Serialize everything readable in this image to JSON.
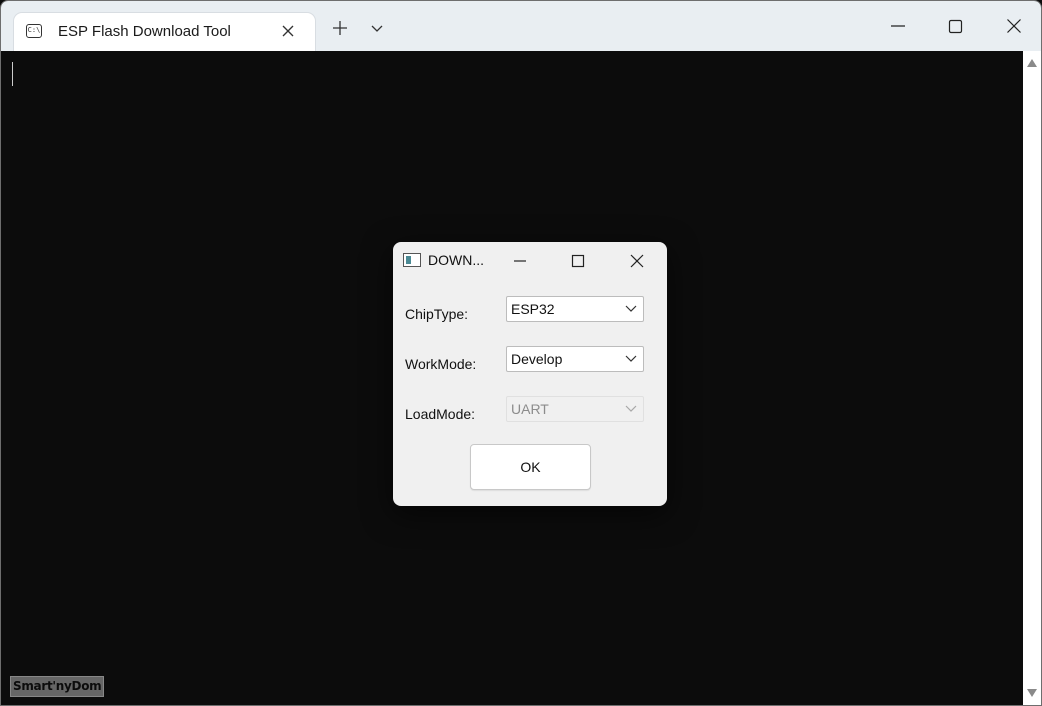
{
  "window": {
    "tab_title": "ESP Flash Download Tool",
    "tab_icon": "terminal-icon"
  },
  "dialog": {
    "title": "DOWN...",
    "fields": [
      {
        "label": "ChipType:",
        "value": "ESP32",
        "enabled": true
      },
      {
        "label": "WorkMode:",
        "value": "Develop",
        "enabled": true
      },
      {
        "label": "LoadMode:",
        "value": "UART",
        "enabled": false
      }
    ],
    "ok_label": "OK"
  },
  "watermark": "Smart'nyDom",
  "colors": {
    "titlebar": "#e9eef2",
    "terminal_background": "#0c0c0c",
    "dialog_background": "#f0f0f0",
    "dialog_icon_accent": "#4b8a94"
  }
}
